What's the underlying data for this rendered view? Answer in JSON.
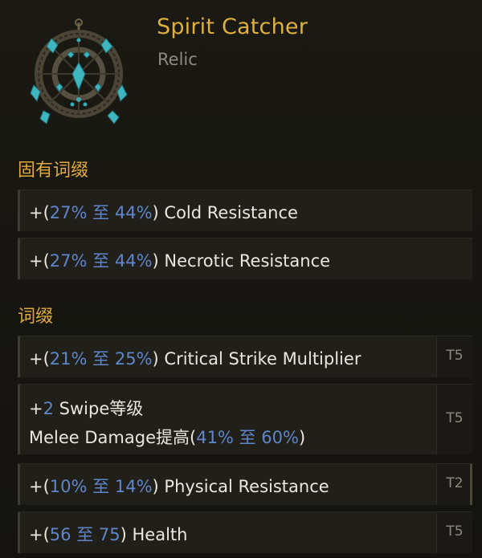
{
  "item": {
    "name": "Spirit Catcher",
    "type": "Relic",
    "icon": "dreamcatcher-relic-icon"
  },
  "sections": {
    "implicit_title": "固有词缀",
    "affix_title": "词缀"
  },
  "implicits": [
    {
      "prefix": "+(",
      "min": "27%",
      "sep": " 至 ",
      "max": "44%",
      "suffix": ") Cold Resistance"
    },
    {
      "prefix": "+(",
      "min": "27%",
      "sep": " 至 ",
      "max": "44%",
      "suffix": ") Necrotic Resistance"
    }
  ],
  "affixes": [
    {
      "prefix": "+(",
      "min": "21%",
      "sep": " 至 ",
      "max": "25%",
      "suffix": ") Critical Strike Multiplier",
      "tier": "T5"
    },
    {
      "line1_prefix": "+",
      "line1_val": "2",
      "line1_suffix": " Swipe等级",
      "line2_prefix": "Melee Damage提高(",
      "min": "41%",
      "sep": " 至 ",
      "max": "60%",
      "suffix": ")",
      "tier": "T5"
    },
    {
      "prefix": "+(",
      "min": "10%",
      "sep": " 至 ",
      "max": "14%",
      "suffix": ") Physical Resistance",
      "tier": "T2"
    },
    {
      "prefix": "+(",
      "min": "56",
      "sep": " 至 ",
      "max": "75",
      "suffix": ") Health",
      "tier": "T5"
    }
  ]
}
